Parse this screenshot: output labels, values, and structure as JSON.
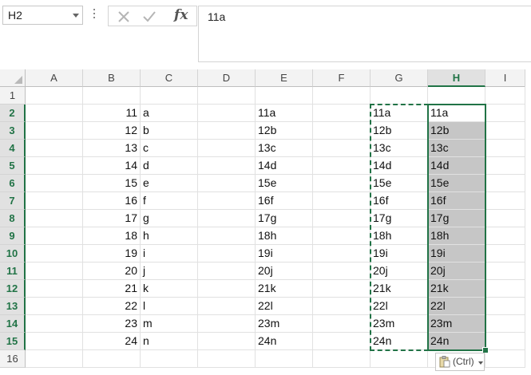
{
  "formula_bar": {
    "name_box": "H2",
    "formula": "11a"
  },
  "columns": [
    "A",
    "B",
    "C",
    "D",
    "E",
    "F",
    "G",
    "H",
    "I"
  ],
  "selected_column": "H",
  "rows": [
    "1",
    "2",
    "3",
    "4",
    "5",
    "6",
    "7",
    "8",
    "9",
    "10",
    "11",
    "12",
    "13",
    "14",
    "15",
    "16"
  ],
  "selected_rows": [
    "2",
    "3",
    "4",
    "5",
    "6",
    "7",
    "8",
    "9",
    "10",
    "11",
    "12",
    "13",
    "14",
    "15"
  ],
  "cells": {
    "B": [
      "",
      "11",
      "12",
      "13",
      "14",
      "15",
      "16",
      "17",
      "18",
      "19",
      "20",
      "21",
      "22",
      "23",
      "24",
      ""
    ],
    "C": [
      "",
      "a",
      "b",
      "c",
      "d",
      "e",
      "f",
      "g",
      "h",
      "i",
      "j",
      "k",
      "l",
      "m",
      "n",
      ""
    ],
    "E": [
      "",
      "11a",
      "12b",
      "13c",
      "14d",
      "15e",
      "16f",
      "17g",
      "18h",
      "19i",
      "20j",
      "21k",
      "22l",
      "23m",
      "24n",
      ""
    ],
    "G": [
      "",
      "11a",
      "12b",
      "13c",
      "14d",
      "15e",
      "16f",
      "17g",
      "18h",
      "19i",
      "20j",
      "21k",
      "22l",
      "23m",
      "24n",
      ""
    ],
    "H": [
      "",
      "11a",
      "12b",
      "13c",
      "14d",
      "15e",
      "16f",
      "17g",
      "18h",
      "19i",
      "20j",
      "21k",
      "22l",
      "23m",
      "24n",
      ""
    ]
  },
  "paste_options": {
    "label": "(Ctrl)"
  },
  "colors": {
    "accent": "#217346",
    "selection_fill": "#c6c6c6"
  },
  "icons": [
    "cancel-icon",
    "enter-icon",
    "insert-function-icon",
    "paste-options-icon"
  ]
}
